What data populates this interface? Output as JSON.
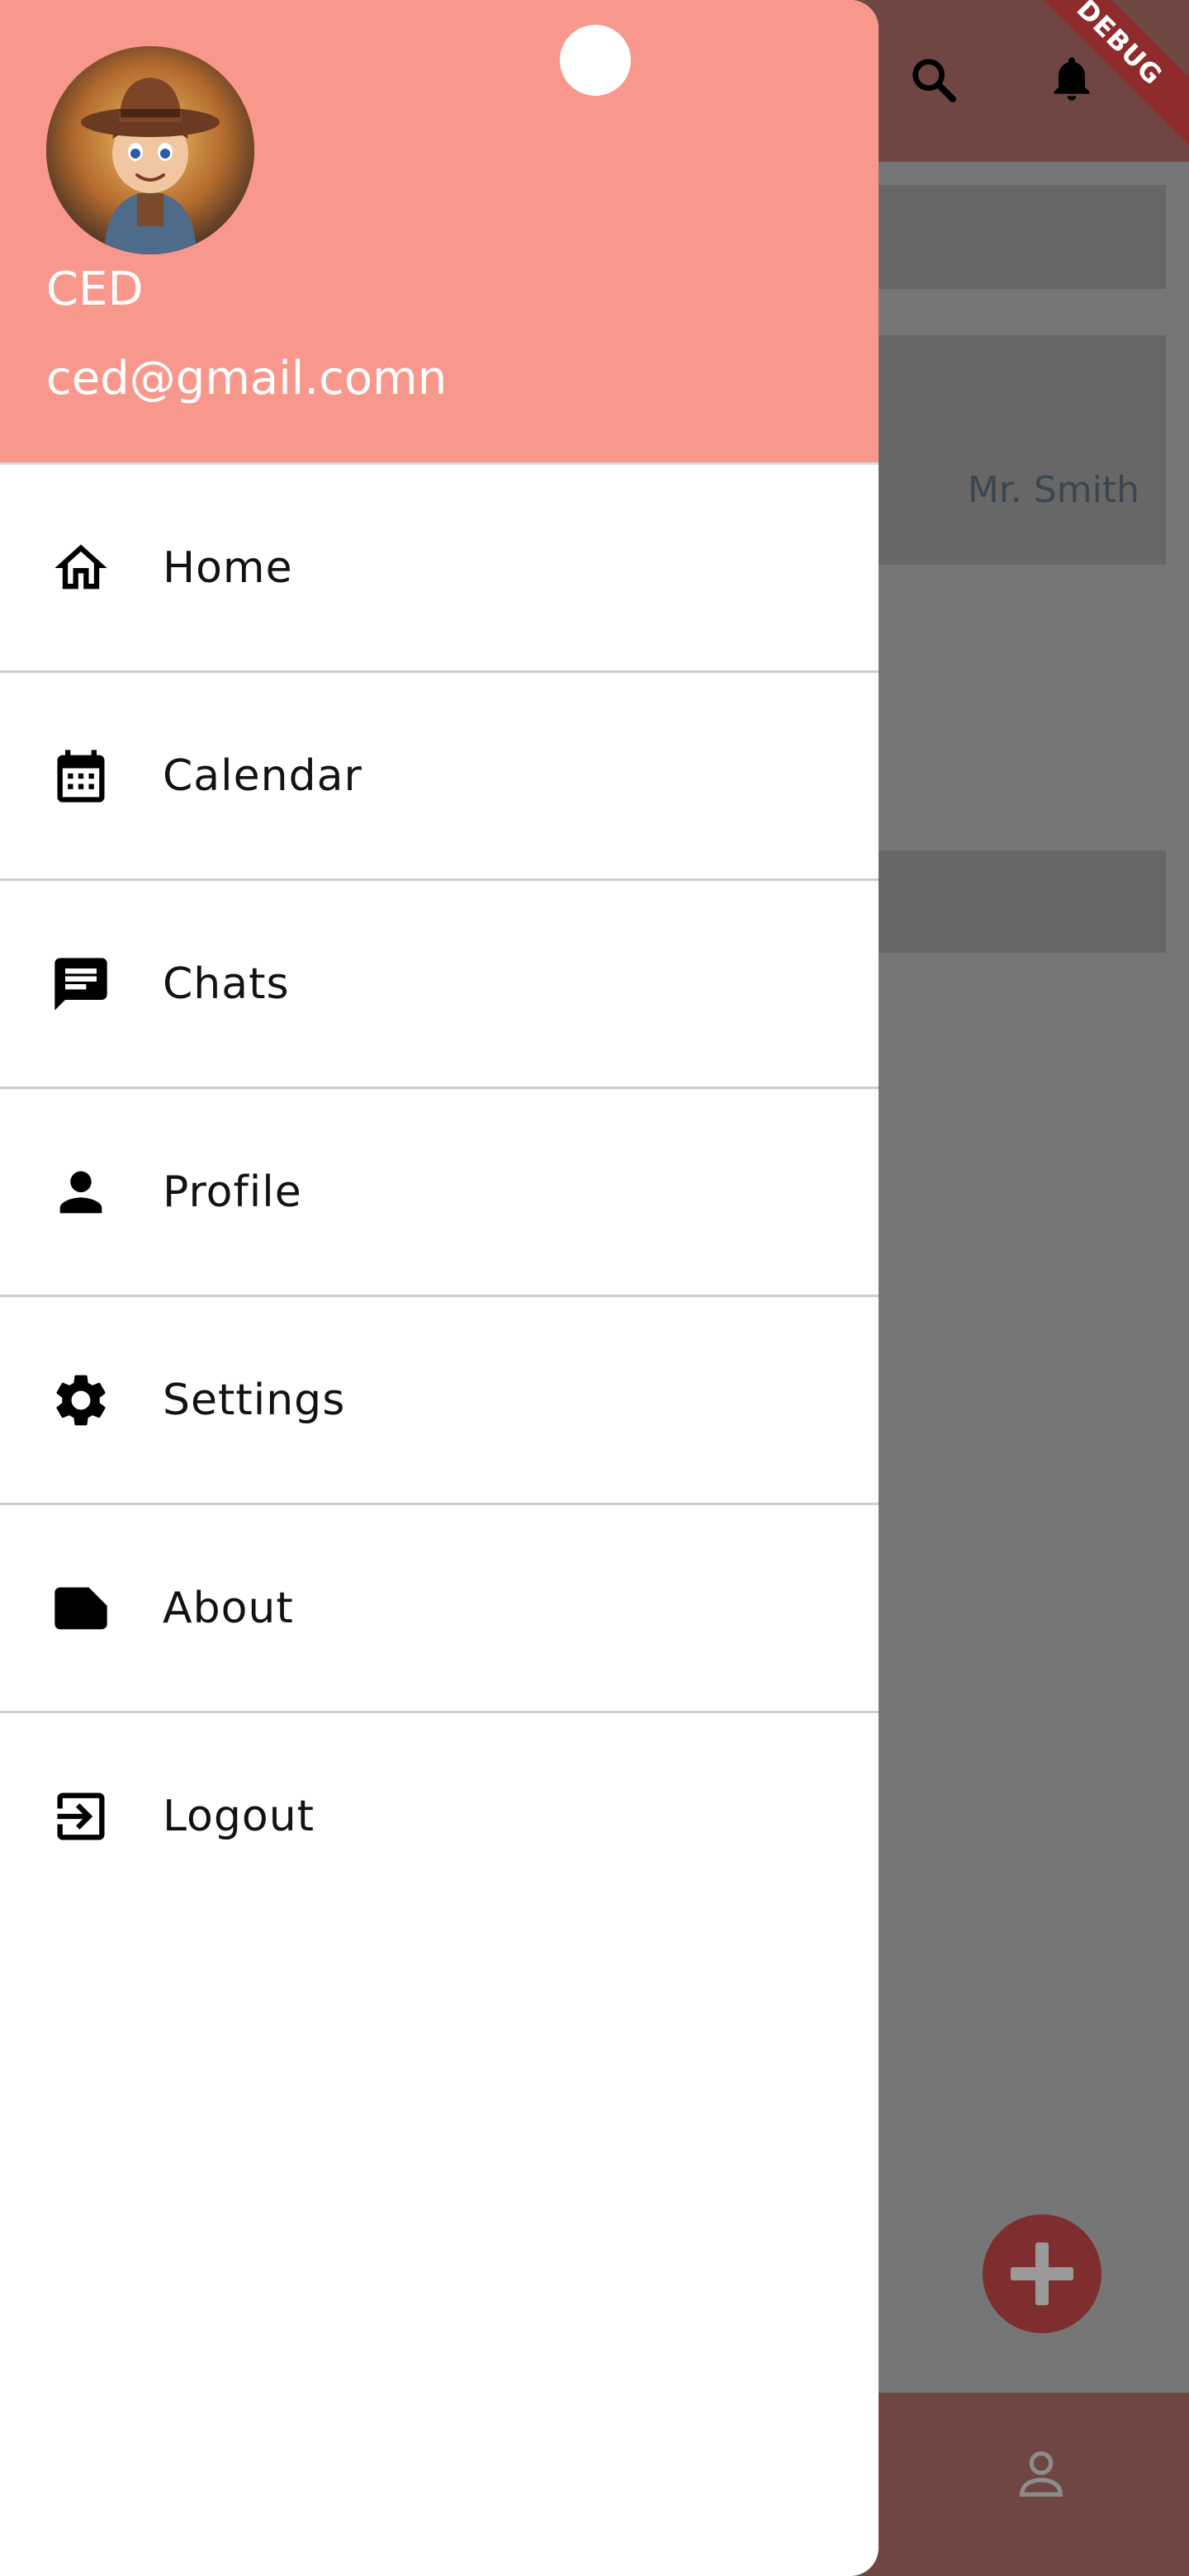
{
  "background": {
    "card_text": "Mr. Smith",
    "debug_label": "DEBUG",
    "icons": [
      "search-icon",
      "bell-icon",
      "add-icon",
      "person-outline-icon"
    ],
    "colors": {
      "appbar": "#6f4642",
      "fab": "#7e2e2e",
      "scrim": "#767676"
    }
  },
  "drawer": {
    "header": {
      "name": "CED",
      "email": "ced@gmail.comn",
      "color": "#f8978c"
    },
    "items": [
      {
        "label": "Home",
        "icon": "home-icon"
      },
      {
        "label": "Calendar",
        "icon": "calendar-icon"
      },
      {
        "label": "Chats",
        "icon": "chat-icon"
      },
      {
        "label": "Profile",
        "icon": "person-icon"
      },
      {
        "label": "Settings",
        "icon": "settings-icon"
      },
      {
        "label": "About",
        "icon": "note-icon"
      },
      {
        "label": "Logout",
        "icon": "logout-icon"
      }
    ]
  }
}
